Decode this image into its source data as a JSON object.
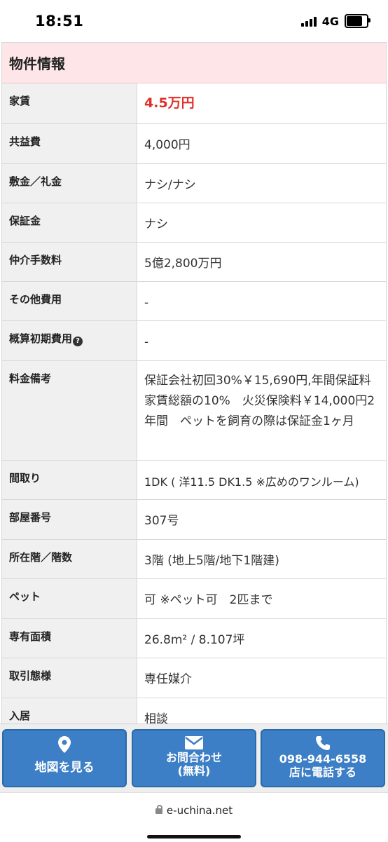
{
  "status": {
    "time": "18:51",
    "network": "4G"
  },
  "section": {
    "title": "物件情報",
    "rows": [
      {
        "label": "家賃",
        "value": "4.5万円"
      },
      {
        "label": "共益費",
        "value": "4,000円"
      },
      {
        "label": "敷金／礼金",
        "value": "ナシ/ナシ"
      },
      {
        "label": "保証金",
        "value": "ナシ"
      },
      {
        "label": "仲介手数料",
        "value": "5億2,800万円"
      },
      {
        "label": "その他費用",
        "value": "-"
      },
      {
        "label": "概算初期費用",
        "value": "-"
      },
      {
        "label": "料金備考",
        "value": "保証会社初回30%￥15,690円,年間保証料家賃総額の10%　火災保険料￥14,000円2年間　ペットを飼育の際は保証金1ヶ月"
      },
      {
        "label": "間取り",
        "value": "1DK ( 洋11.5 DK1.5 ※広めのワンルーム)"
      },
      {
        "label": "部屋番号",
        "value": "307号"
      },
      {
        "label": "所在階／階数",
        "value": "3階 (地上5階/地下1階建)"
      },
      {
        "label": "ペット",
        "value": "可 ※ペット可　2匹まで"
      },
      {
        "label": "専有面積",
        "value": "26.8m² / 8.107坪"
      },
      {
        "label": "取引態様",
        "value": "専任媒介"
      },
      {
        "label": "入居",
        "value": "相談"
      }
    ]
  },
  "actions": {
    "map": {
      "label": "地図を見る",
      "icon": "map-pin-icon"
    },
    "inquiry": {
      "line1": "お問合わせ",
      "line2": "(無料)",
      "icon": "envelope-icon"
    },
    "phone": {
      "line1": "098-944-6558",
      "line2": "店に電話する",
      "icon": "phone-icon"
    }
  },
  "browser": {
    "url": "e-uchina.net"
  },
  "colors": {
    "header_bg": "#fde5e8",
    "rent": "#e0302a",
    "button": "#3d7fc6",
    "label_bg": "#f0f0f0"
  }
}
